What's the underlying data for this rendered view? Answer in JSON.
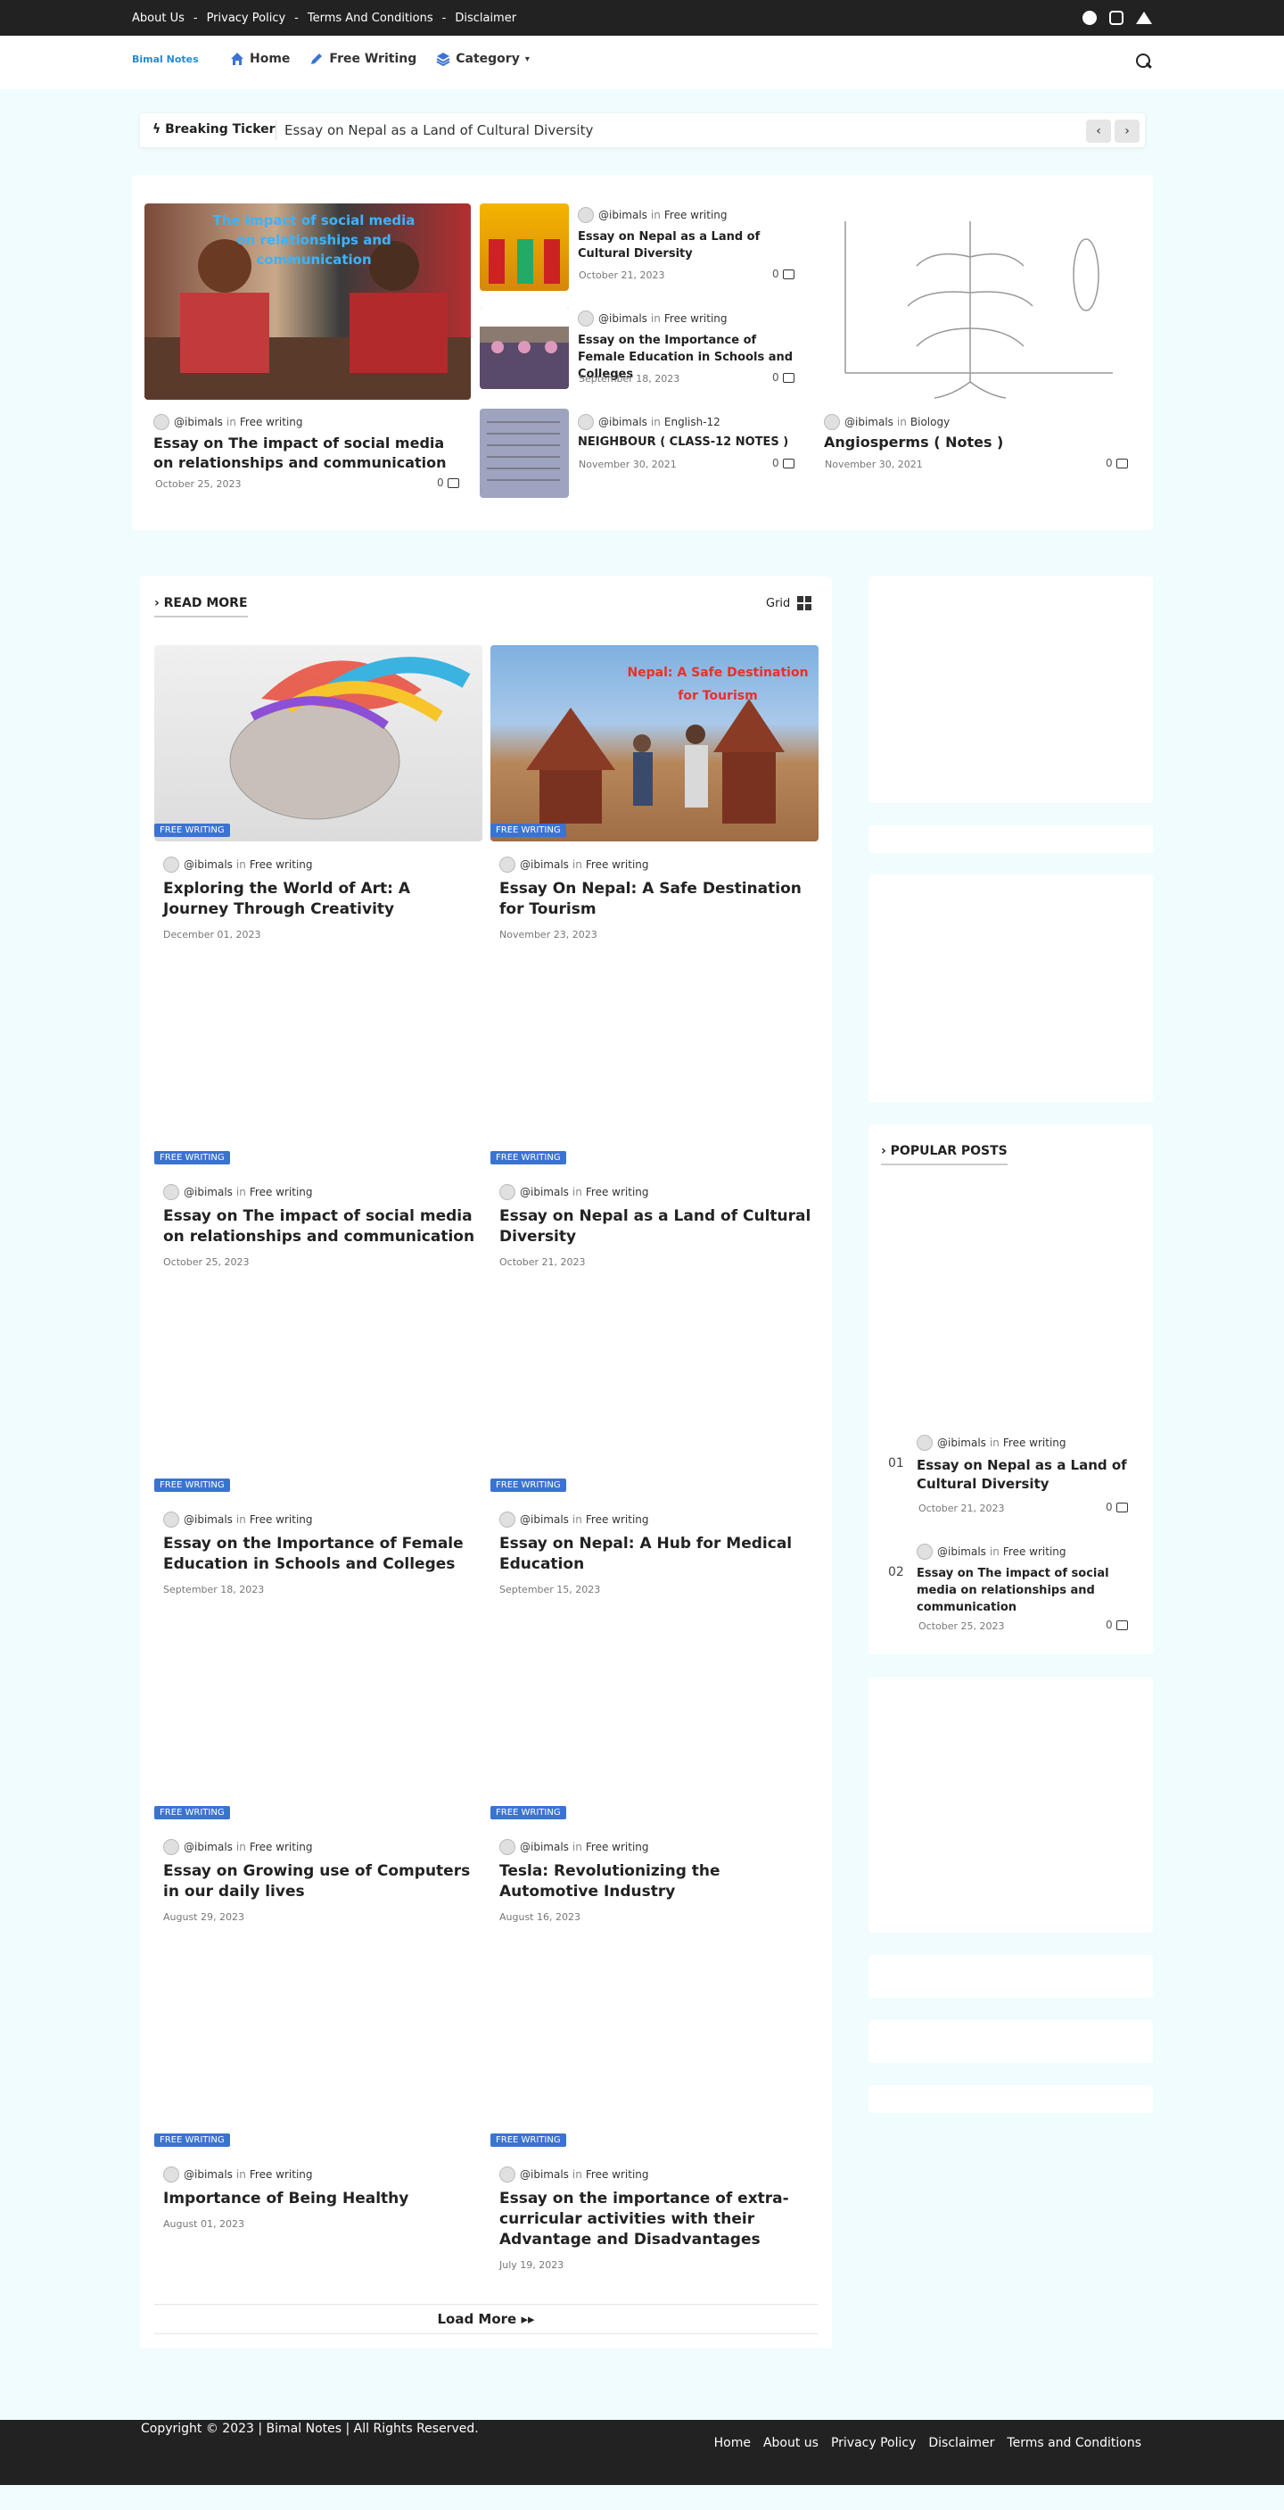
{
  "topbar": {
    "links": [
      "About Us",
      "Privacy Policy",
      "Terms And Conditions",
      "Disclaimer"
    ],
    "separator": "-",
    "social": [
      "facebook-icon",
      "instagram-icon",
      "twitter-icon"
    ]
  },
  "header": {
    "logo": "Bimal Notes",
    "nav": [
      {
        "label": "Home",
        "icon": "home-icon"
      },
      {
        "label": "Free Writing",
        "icon": "pen-icon"
      },
      {
        "label": "Category",
        "icon": "layers-icon"
      }
    ],
    "search_icon": "search-icon"
  },
  "ticker": {
    "label": "Breaking Ticker",
    "text": "Essay on Nepal as a Land of Cultural Diversity",
    "prev": "‹",
    "next": "›"
  },
  "featured": {
    "main": {
      "image_text": "The impact of social media on relationships and communication",
      "author": "@ibimals",
      "in": "in",
      "category": "Free writing",
      "title": "Essay on The impact of social media on relationships and communication",
      "date": "October 25, 2023",
      "comments": "0"
    },
    "list": [
      {
        "author": "@ibimals",
        "in": "in",
        "category": "Free writing",
        "title": "Essay on Nepal as a Land of Cultural Diversity",
        "date": "October 21, 2023",
        "comments": "0"
      },
      {
        "author": "@ibimals",
        "in": "in",
        "category": "Free writing",
        "title": "Essay on the Importance of Female Education in Schools and Colleges",
        "date": "September 18, 2023",
        "comments": "0"
      },
      {
        "author": "@ibimals",
        "in": "in",
        "category": "English-12",
        "title": "NEIGHBOUR ( CLASS-12 NOTES )",
        "date": "November 30, 2021",
        "comments": "0"
      }
    ],
    "side": {
      "author": "@ibimals",
      "in": "in",
      "category": "Biology",
      "title": "Angiosperms ( Notes )",
      "date": "November 30, 2021",
      "comments": "0"
    }
  },
  "readmore": {
    "heading": "READ MORE",
    "grid_label": "Grid",
    "badge": "FREE WRITING",
    "posts": [
      {
        "author": "@ibimals",
        "in": "in",
        "category": "Free writing",
        "title": "Exploring the World of Art: A Journey Through Creativity",
        "date": "December 01, 2023"
      },
      {
        "author": "@ibimals",
        "in": "in",
        "category": "Free writing",
        "title": "Essay On Nepal: A Safe Destination for Tourism",
        "date": "November 23, 2023",
        "image_text": "Nepal: A Safe Destination for Tourism"
      },
      {
        "author": "@ibimals",
        "in": "in",
        "category": "Free writing",
        "title": "Essay on The impact of social media on relationships and communication",
        "date": "October 25, 2023"
      },
      {
        "author": "@ibimals",
        "in": "in",
        "category": "Free writing",
        "title": "Essay on Nepal as a Land of Cultural Diversity",
        "date": "October 21, 2023"
      },
      {
        "author": "@ibimals",
        "in": "in",
        "category": "Free writing",
        "title": "Essay on the Importance of Female Education in Schools and Colleges",
        "date": "September 18, 2023"
      },
      {
        "author": "@ibimals",
        "in": "in",
        "category": "Free writing",
        "title": "Essay on Nepal: A Hub for Medical Education",
        "date": "September 15, 2023"
      },
      {
        "author": "@ibimals",
        "in": "in",
        "category": "Free writing",
        "title": "Essay on Growing use of Computers in our daily lives",
        "date": "August 29, 2023"
      },
      {
        "author": "@ibimals",
        "in": "in",
        "category": "Free writing",
        "title": "Tesla: Revolutionizing the Automotive Industry",
        "date": "August 16, 2023"
      },
      {
        "author": "@ibimals",
        "in": "in",
        "category": "Free writing",
        "title": "Importance of Being Healthy",
        "date": "August 01, 2023"
      },
      {
        "author": "@ibimals",
        "in": "in",
        "category": "Free writing",
        "title": "Essay on the importance of extra-curricular activities with their Advantage and Disadvantages",
        "date": "July 19, 2023"
      }
    ],
    "load_more": "Load More"
  },
  "popular": {
    "heading": "POPULAR POSTS",
    "items": [
      {
        "num": "01",
        "author": "@ibimals",
        "in": "in",
        "category": "Free writing",
        "title": "Essay on Nepal as a Land of Cultural Diversity",
        "date": "October 21, 2023",
        "comments": "0"
      },
      {
        "num": "02",
        "author": "@ibimals",
        "in": "in",
        "category": "Free writing",
        "title": "Essay on The impact of social media on relationships and communication",
        "date": "October 25, 2023",
        "comments": "0"
      }
    ]
  },
  "footer": {
    "copyright": "Copyright © 2023 | Bimal Notes | All Rights Reserved.",
    "links": [
      "Home",
      "About us",
      "Privacy Policy",
      "Disclaimer",
      "Terms and Conditions"
    ]
  },
  "colors": {
    "accent": "#3b73d1",
    "dark": "#222222",
    "background": "#f0fcfd",
    "logo": "#1f8bd8"
  }
}
